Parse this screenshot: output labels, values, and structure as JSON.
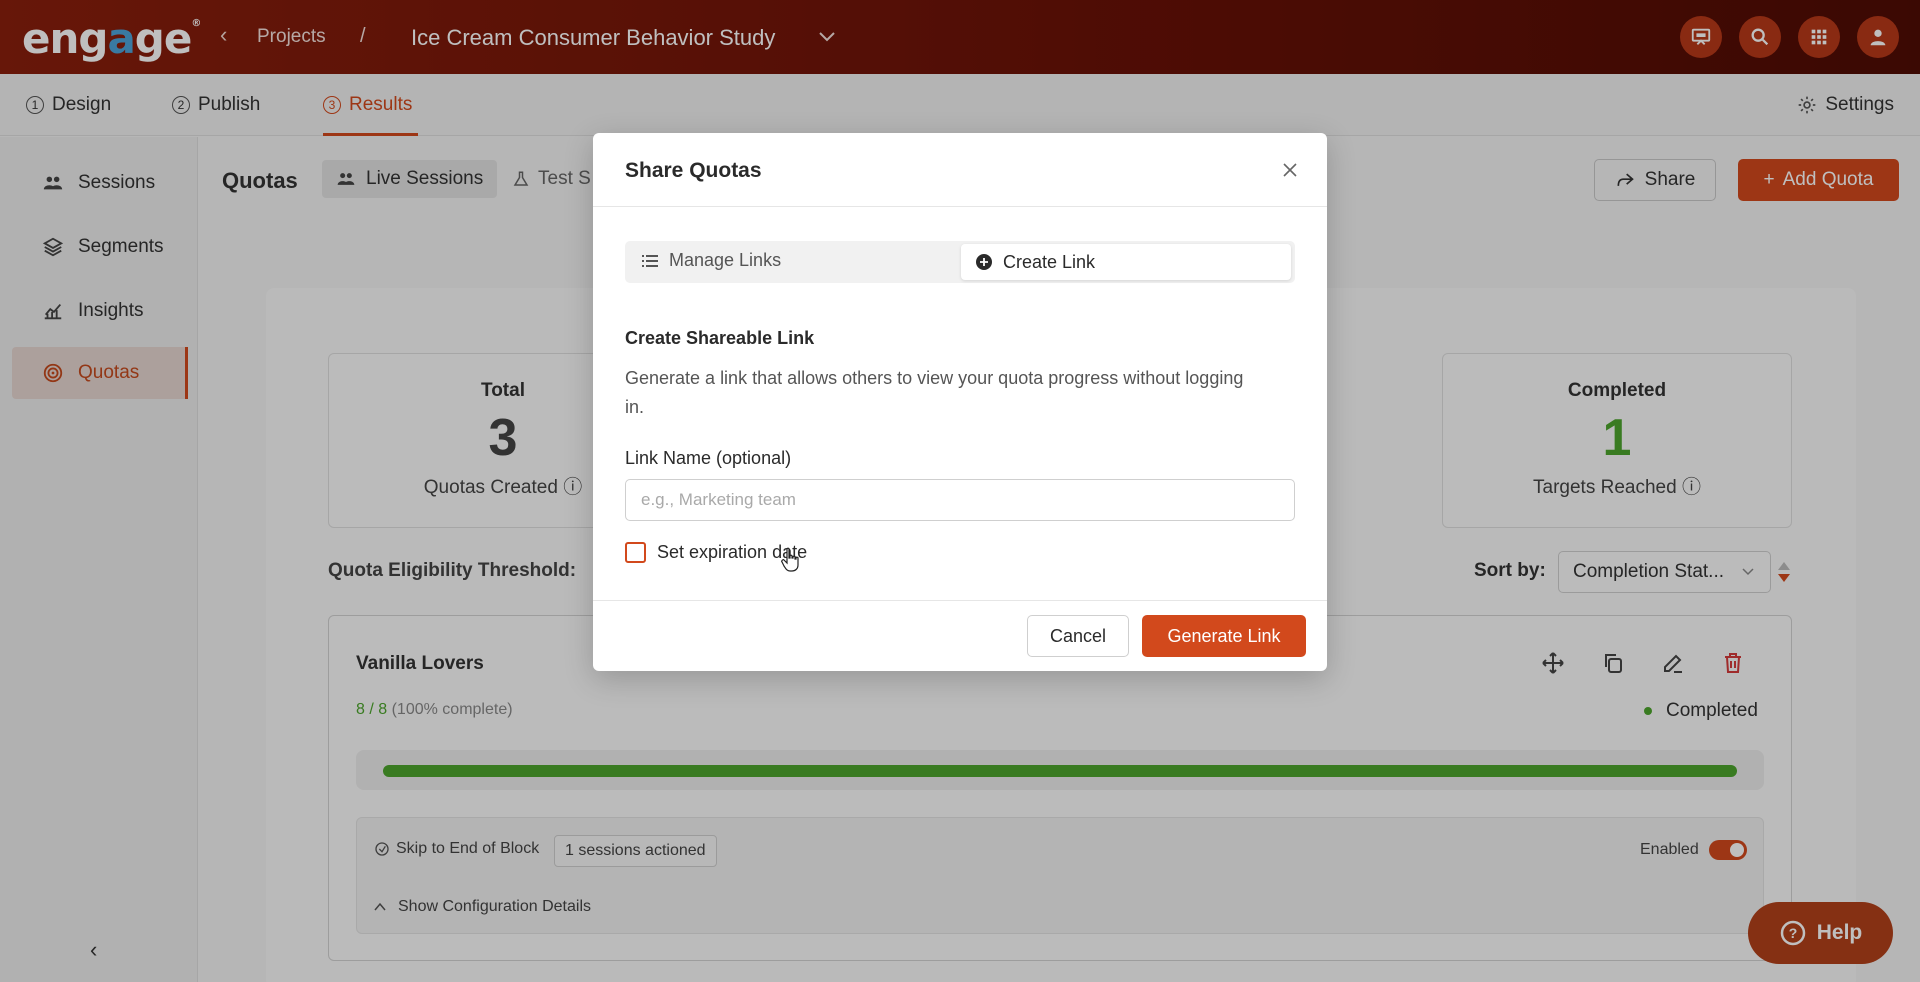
{
  "header": {
    "logo_text": "engage",
    "breadcrumb_projects": "Projects",
    "breadcrumb_separator": "/",
    "project_title": "Ice Cream Consumer Behavior Study"
  },
  "steps": [
    {
      "num": "1",
      "label": "Design"
    },
    {
      "num": "2",
      "label": "Publish"
    },
    {
      "num": "3",
      "label": "Results"
    }
  ],
  "settings_label": "Settings",
  "sidebar": {
    "items": [
      {
        "label": "Sessions"
      },
      {
        "label": "Segments"
      },
      {
        "label": "Insights"
      },
      {
        "label": "Quotas"
      }
    ]
  },
  "toolbar": {
    "title": "Quotas",
    "tab_live": "Live Sessions",
    "tab_test": "Test S",
    "share_label": "Share",
    "add_quota_label": "Add Quota"
  },
  "stats": {
    "total": {
      "label": "Total",
      "value": "3",
      "sub": "Quotas Created"
    },
    "completed": {
      "label": "Completed",
      "value": "1",
      "sub": "Targets Reached"
    }
  },
  "threshold_label": "Quota Eligibility Threshold:",
  "sort": {
    "label": "Sort by:",
    "selected": "Completion Stat..."
  },
  "quota": {
    "name": "Vanilla Lovers",
    "progress_count": "8 / 8",
    "progress_pct": "(100% complete)",
    "progress_fraction": 1.0,
    "status": "Completed",
    "action_label": "Skip to End of Block",
    "sessions_actioned": "1 sessions actioned",
    "enabled_label": "Enabled",
    "enabled": true,
    "show_config_label": "Show Configuration Details"
  },
  "help_label": "Help",
  "modal": {
    "title": "Share Quotas",
    "tab_manage": "Manage Links",
    "tab_create": "Create Link",
    "section_title": "Create Shareable Link",
    "section_desc": "Generate a link that allows others to view your quota progress without logging in.",
    "field_label": "Link Name (optional)",
    "field_placeholder": "e.g., Marketing team",
    "field_value": "",
    "checkbox_label": "Set expiration date",
    "cancel_label": "Cancel",
    "generate_label": "Generate Link"
  },
  "colors": {
    "brand": "#d2491c",
    "header": "#6b1207",
    "success": "#4ca52c"
  }
}
